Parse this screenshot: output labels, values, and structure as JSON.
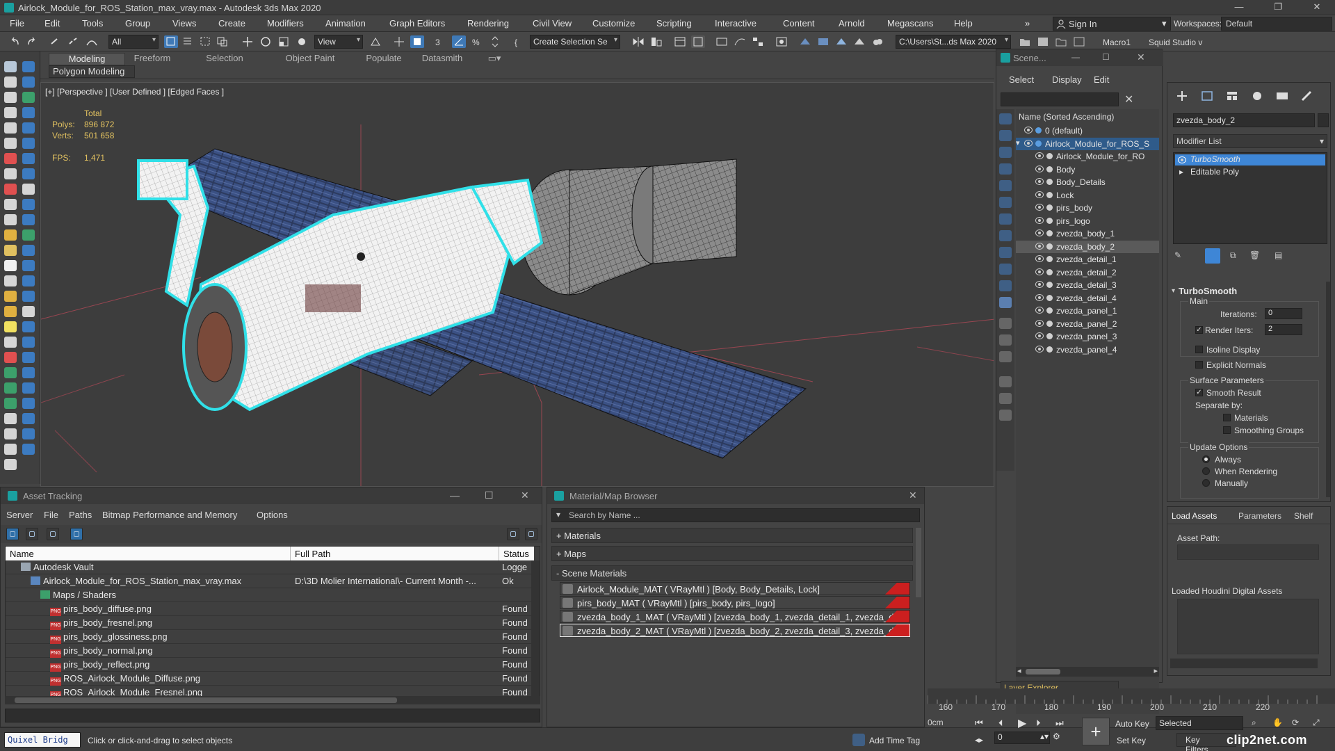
{
  "window": {
    "title": "Airlock_Module_for_ROS_Station_max_vray.max - Autodesk 3ds Max 2020",
    "controls": {
      "minimize": "—",
      "restore": "❐",
      "close": "✕"
    }
  },
  "menubar": {
    "items": [
      "File",
      "Edit",
      "Tools",
      "Group",
      "Views",
      "Create",
      "Modifiers",
      "Animation",
      "Graph Editors",
      "Rendering",
      "Civil View",
      "Customize",
      "Scripting",
      "Interactive",
      "Content",
      "Arnold",
      "Megascans",
      "Help"
    ],
    "overflow": "»",
    "sign_in": "Sign In",
    "workspaces_label": "Workspaces:",
    "workspace_value": "Default"
  },
  "toolbar": {
    "filter_value": "All",
    "refcoord_value": "View",
    "selection_set_value": "Create Selection Se",
    "path_value": "C:\\Users\\St...ds Max 2020",
    "macro_label": "Macro1",
    "studio_label": "Squid Studio v"
  },
  "ribbon": {
    "tabs": [
      "Modeling",
      "Freeform",
      "Selection",
      "Object Paint",
      "Populate",
      "Datasmith"
    ],
    "active_tab": "Modeling",
    "sub_label": "Polygon Modeling"
  },
  "viewport": {
    "label": "[+] [Perspective ] [User Defined ] [Edged Faces ]",
    "stats": {
      "total_label": "Total",
      "polys_label": "Polys:",
      "polys_value": "896 872",
      "verts_label": "Verts:",
      "verts_value": "501 658",
      "fps_label": "FPS:",
      "fps_value": "1,471"
    }
  },
  "scene_explorer": {
    "title": "Scene...",
    "menu": [
      "Select",
      "Display",
      "Edit"
    ],
    "column_header": "Name (Sorted Ascending)",
    "rows": [
      {
        "label": "0 (default)",
        "indent": 1
      },
      {
        "label": "Airlock_Module_for_ROS_S",
        "indent": 1
      },
      {
        "label": "Airlock_Module_for_RO",
        "indent": 2
      },
      {
        "label": "Body",
        "indent": 2
      },
      {
        "label": "Body_Details",
        "indent": 2
      },
      {
        "label": "Lock",
        "indent": 2
      },
      {
        "label": "pirs_body",
        "indent": 2
      },
      {
        "label": "pirs_logo",
        "indent": 2
      },
      {
        "label": "zvezda_body_1",
        "indent": 2
      },
      {
        "label": "zvezda_body_2",
        "indent": 2
      },
      {
        "label": "zvezda_detail_1",
        "indent": 2
      },
      {
        "label": "zvezda_detail_2",
        "indent": 2
      },
      {
        "label": "zvezda_detail_3",
        "indent": 2
      },
      {
        "label": "zvezda_detail_4",
        "indent": 2
      },
      {
        "label": "zvezda_panel_1",
        "indent": 2
      },
      {
        "label": "zvezda_panel_2",
        "indent": 2
      },
      {
        "label": "zvezda_panel_3",
        "indent": 2
      },
      {
        "label": "zvezda_panel_4",
        "indent": 2
      }
    ],
    "selected_row": "zvezda_body_2",
    "layer_explorer": "Layer Explorer"
  },
  "command_panel": {
    "object_name": "zvezda_body_2",
    "modifier_list": "Modifier List",
    "stack": [
      "TurboSmooth",
      "Editable Poly"
    ],
    "turbosmooth": {
      "title": "TurboSmooth",
      "main_label": "Main",
      "iterations_label": "Iterations:",
      "iterations_value": "0",
      "render_iters_label": "Render Iters:",
      "render_iters_value": "2",
      "isoline_label": "Isoline Display",
      "explicit_normals_label": "Explicit Normals",
      "surface_params_label": "Surface Parameters",
      "smooth_result_label": "Smooth Result",
      "separate_by_label": "Separate by:",
      "materials_label": "Materials",
      "smoothing_groups_label": "Smoothing Groups",
      "update_options_label": "Update Options",
      "always_label": "Always",
      "when_rendering_label": "When Rendering",
      "manually_label": "Manually"
    }
  },
  "houdini": {
    "tabs": [
      "Load Assets",
      "Parameters",
      "Shelf"
    ],
    "asset_path_label": "Asset Path:",
    "loaded_label": "Loaded Houdini Digital Assets"
  },
  "asset_tracking": {
    "title": "Asset Tracking",
    "menu": [
      "Server",
      "File",
      "Paths",
      "Bitmap Performance and Memory",
      "Options"
    ],
    "columns": [
      "Name",
      "Full Path",
      "Status"
    ],
    "rows": [
      {
        "name": "Autodesk Vault",
        "path": "",
        "status": "Logge",
        "indent": 1,
        "icon": "vault"
      },
      {
        "name": "Airlock_Module_for_ROS_Station_max_vray.max",
        "path": "D:\\3D Molier International\\- Current Month -...",
        "status": "Ok",
        "indent": 2,
        "icon": "file"
      },
      {
        "name": "Maps / Shaders",
        "path": "",
        "status": "",
        "indent": 3,
        "icon": "folder"
      },
      {
        "name": "pirs_body_diffuse.png",
        "path": "",
        "status": "Found",
        "indent": 4,
        "icon": "png"
      },
      {
        "name": "pirs_body_fresnel.png",
        "path": "",
        "status": "Found",
        "indent": 4,
        "icon": "png"
      },
      {
        "name": "pirs_body_glossiness.png",
        "path": "",
        "status": "Found",
        "indent": 4,
        "icon": "png"
      },
      {
        "name": "pirs_body_normal.png",
        "path": "",
        "status": "Found",
        "indent": 4,
        "icon": "png"
      },
      {
        "name": "pirs_body_reflect.png",
        "path": "",
        "status": "Found",
        "indent": 4,
        "icon": "png"
      },
      {
        "name": "ROS_Airlock_Module_Diffuse.png",
        "path": "",
        "status": "Found",
        "indent": 4,
        "icon": "png"
      },
      {
        "name": "ROS_Airlock_Module_Fresnel.png",
        "path": "",
        "status": "Found",
        "indent": 4,
        "icon": "png"
      }
    ]
  },
  "material_browser": {
    "title": "Material/Map Browser",
    "search_placeholder": "Search by Name ...",
    "sections": [
      "+ Materials",
      "+ Maps",
      "- Scene Materials"
    ],
    "items": [
      "Airlock_Module_MAT ( VRayMtl ) [Body, Body_Details, Lock]",
      "pirs_body_MAT ( VRayMtl ) [pirs_body, pirs_logo]",
      "zvezda_body_1_MAT ( VRayMtl ) [zvezda_body_1, zvezda_detail_1, zvezda_det...",
      "zvezda_body_2_MAT ( VRayMtl ) [zvezda_body_2, zvezda_detail_3, zvezda_det..."
    ]
  },
  "timeline": {
    "ticks": [
      "160",
      "170",
      "180",
      "190",
      "200",
      "210",
      "220"
    ],
    "zero_label": "0cm"
  },
  "statusbar": {
    "quixel": "Quixel Bridg",
    "prompt": "Click or click-and-drag to select objects",
    "add_time_tag": "Add Time Tag",
    "frame_value": "0",
    "auto_key": "Auto Key",
    "selected": "Selected",
    "set_key": "Set Key",
    "key_filters": "Key Filters...",
    "watermark": "clip2net.com"
  }
}
